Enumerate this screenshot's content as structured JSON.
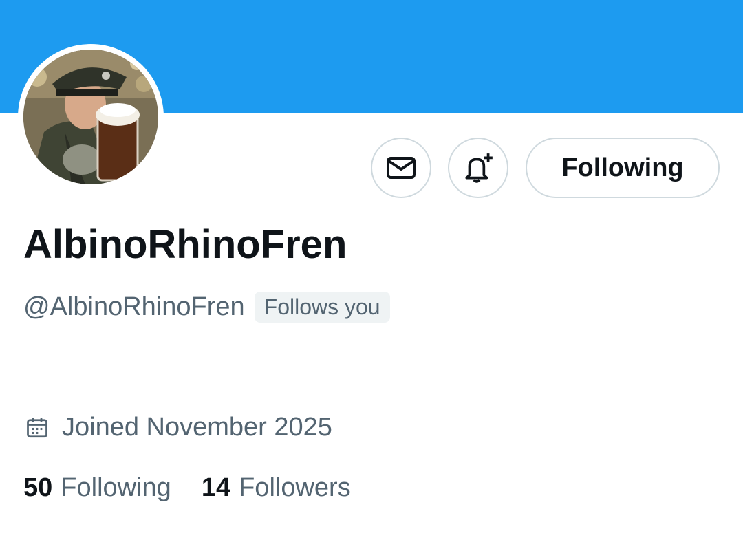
{
  "profile": {
    "display_name": "AlbinoRhinoFren",
    "handle": "@AlbinoRhinoFren",
    "follows_you_badge": "Follows you",
    "joined": "Joined November 2025",
    "avatar_icon": "avatar-photo"
  },
  "actions": {
    "message_icon": "envelope-icon",
    "notify_icon": "bell-plus-icon",
    "follow_label": "Following"
  },
  "stats": {
    "following_count": "50",
    "following_label": "Following",
    "followers_count": "14",
    "followers_label": "Followers"
  },
  "colors": {
    "banner": "#1d9bf0",
    "text_primary": "#0f1419",
    "text_secondary": "#536471",
    "border": "#cfd9de",
    "badge_bg": "#eff3f4"
  }
}
